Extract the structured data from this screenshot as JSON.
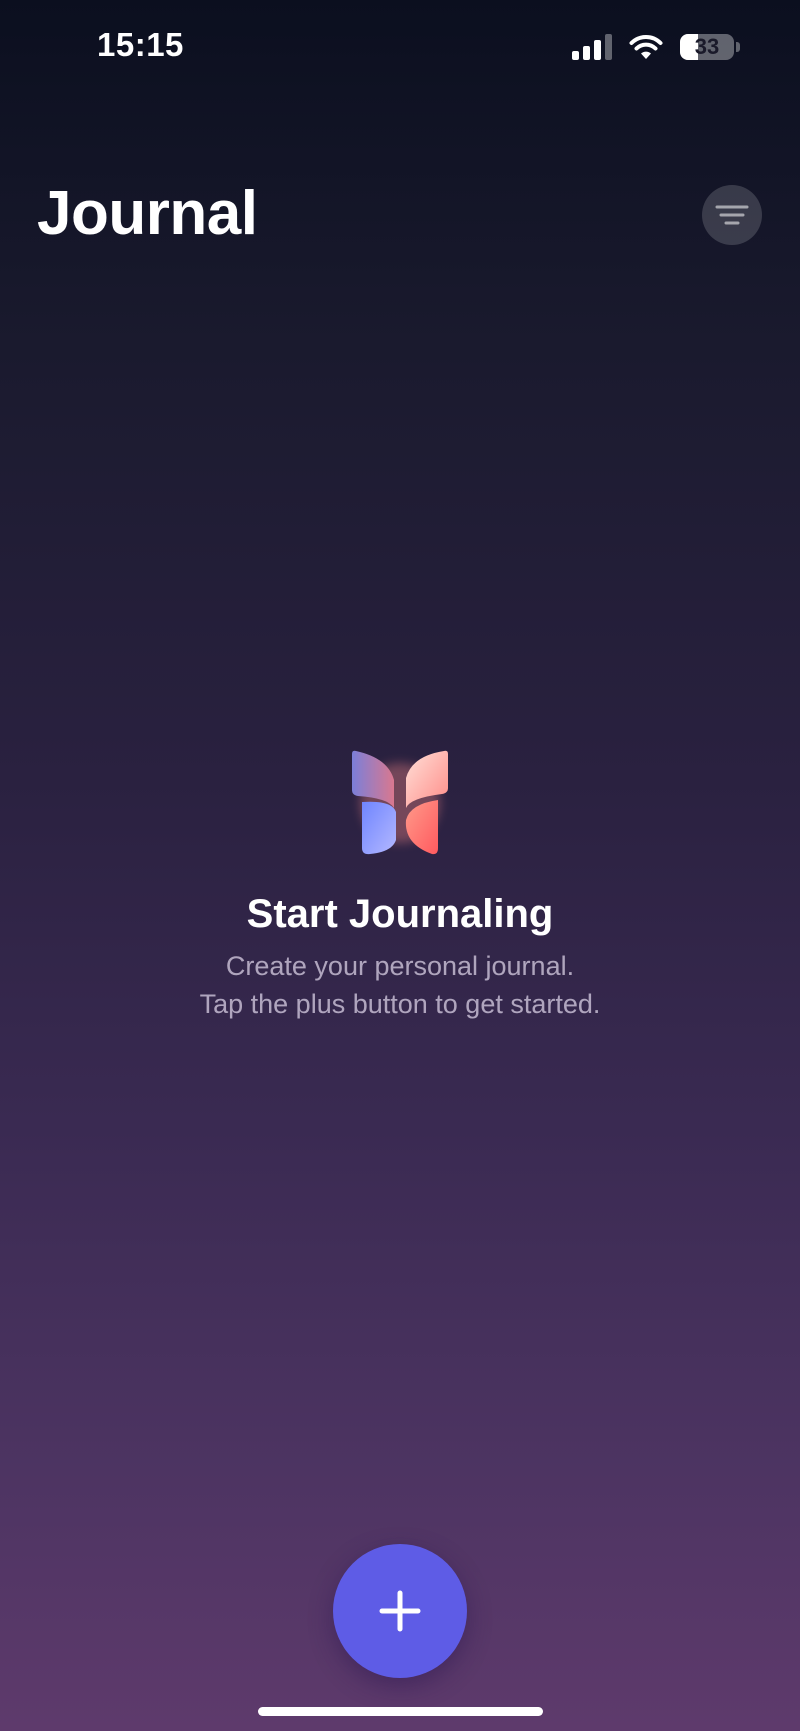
{
  "status_bar": {
    "time": "15:15",
    "battery_level": "33",
    "icons": [
      "signal-icon",
      "wifi-icon",
      "battery-icon"
    ]
  },
  "header": {
    "title": "Journal",
    "filter_icon": "filter-lines-icon"
  },
  "empty_state": {
    "logo_icon": "butterfly-logo-icon",
    "title": "Start Journaling",
    "line1": "Create your personal journal.",
    "line2": "Tap the plus button to get started."
  },
  "fab": {
    "icon": "plus-icon",
    "color": "#5e5ce6"
  },
  "colors": {
    "accent": "#5e5ce6",
    "background_top": "#0b0f1f",
    "background_bottom": "#5e3a6c"
  }
}
